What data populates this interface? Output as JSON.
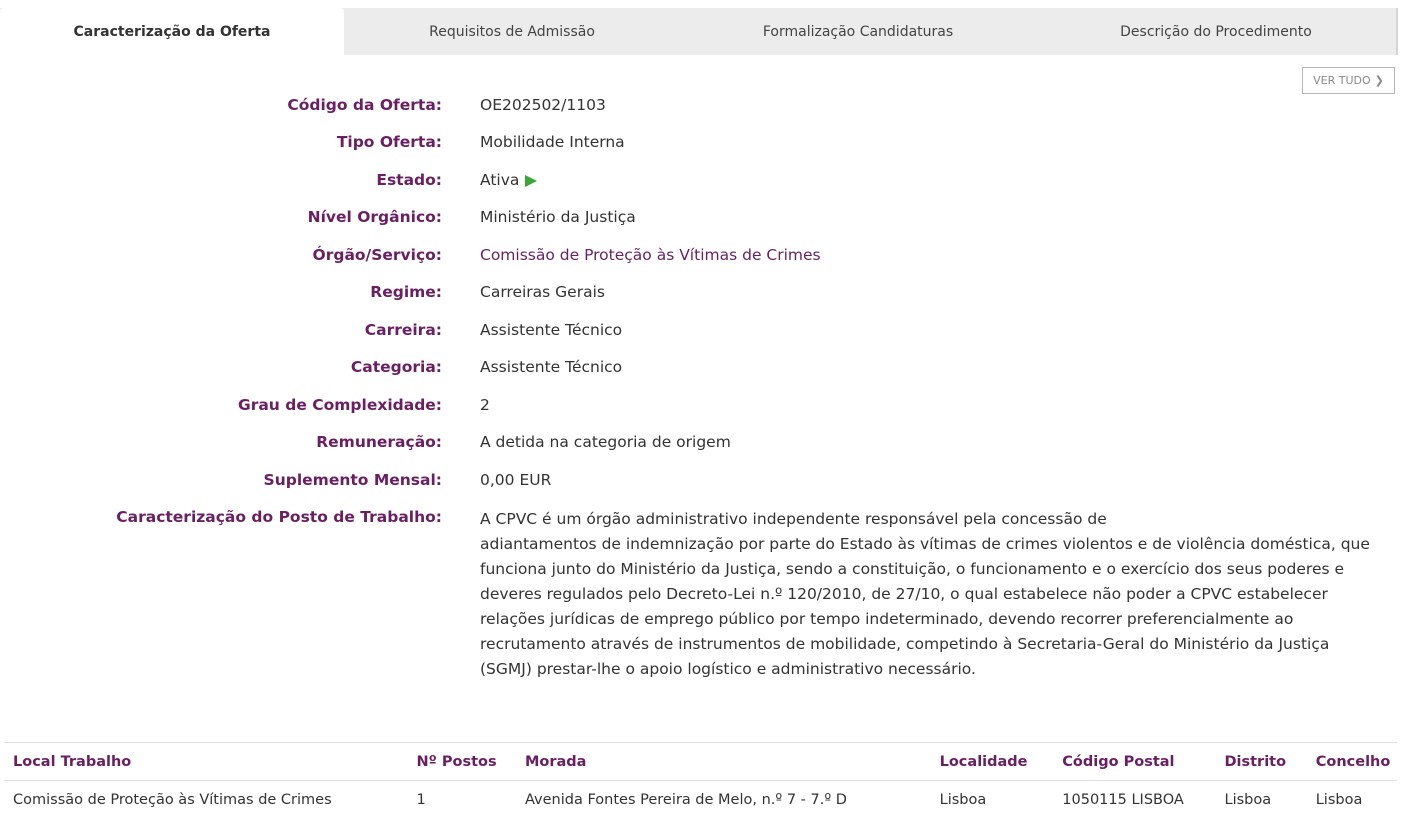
{
  "tabs": [
    {
      "label": "Caracterização da Oferta",
      "active": true
    },
    {
      "label": "Requisitos de Admissão",
      "active": false
    },
    {
      "label": "Formalização Candidaturas",
      "active": false
    },
    {
      "label": "Descrição do Procedimento",
      "active": false
    }
  ],
  "ver_tudo": {
    "label": "VER TUDO",
    "icon": "chevron-down-icon"
  },
  "fields": {
    "codigo": {
      "label": "Código da Oferta:",
      "value": "OE202502/1103"
    },
    "tipo": {
      "label": "Tipo Oferta:",
      "value": "Mobilidade Interna"
    },
    "estado": {
      "label": "Estado:",
      "value": "Ativa",
      "icon": "play-icon",
      "icon_color": "#3aa537"
    },
    "nivel": {
      "label": "Nível Orgânico:",
      "value": "Ministério da Justiça"
    },
    "orgao": {
      "label": "Órgão/Serviço:",
      "value": "Comissão de Proteção às Vítimas de Crimes"
    },
    "regime": {
      "label": "Regime:",
      "value": "Carreiras Gerais"
    },
    "carreira": {
      "label": "Carreira:",
      "value": "Assistente Técnico"
    },
    "categoria": {
      "label": "Categoria:",
      "value": "Assistente Técnico"
    },
    "grau": {
      "label": "Grau de Complexidade:",
      "value": "2"
    },
    "remuneracao": {
      "label": "Remuneração:",
      "value": "A detida na categoria de origem"
    },
    "suplemento": {
      "label": "Suplemento Mensal:",
      "value": "0,00 EUR"
    },
    "posto": {
      "label": "Caracterização do Posto de Trabalho:",
      "lines": [
        "A CPVC é um órgão administrativo independente responsável pela concessão de",
        "adiantamentos de indemnização por parte do Estado às vítimas de crimes violentos e de violência doméstica, que",
        "funciona junto do Ministério da Justiça, sendo a constituição, o funcionamento e o exercício dos seus poderes e",
        "deveres regulados pelo Decreto-Lei n.º 120/2010, de 27/10, o qual estabelece não poder a CPVC estabelecer",
        "relações jurídicas de emprego público por tempo indeterminado, devendo recorrer preferencialmente ao",
        "recrutamento através de instrumentos de mobilidade, competindo à Secretaria-Geral do Ministério da Justiça",
        "(SGMJ) prestar-lhe o apoio logístico e administrativo necessário."
      ]
    }
  },
  "table": {
    "headers": [
      "Local Trabalho",
      "Nº Postos",
      "Morada",
      "Localidade",
      "Código Postal",
      "Distrito",
      "Concelho"
    ],
    "rows": [
      [
        "Comissão de Proteção às Vítimas de Crimes",
        "1",
        "Avenida Fontes Pereira de Melo, n.º 7 - 7.º D",
        "Lisboa",
        "1050115 LISBOA",
        "Lisboa",
        "Lisboa"
      ]
    ]
  },
  "colors": {
    "label_purple": "#6b1f63",
    "text": "#333333",
    "tab_bg": "#ececec",
    "status_green": "#3aa537"
  }
}
